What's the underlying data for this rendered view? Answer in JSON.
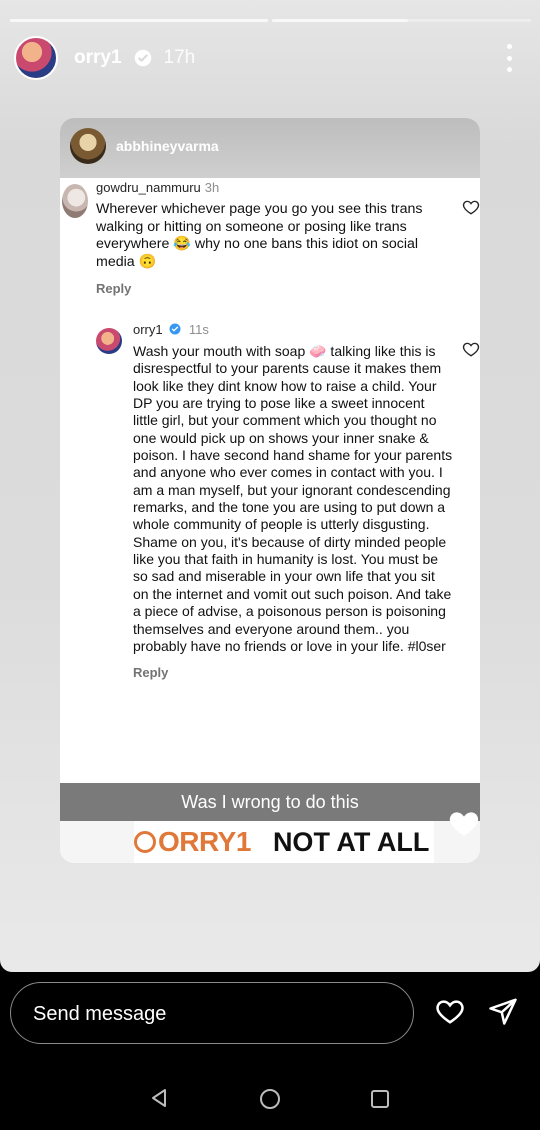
{
  "story": {
    "username": "orry1",
    "time": "17h"
  },
  "card": {
    "username": "abbhineyvarma"
  },
  "comment1": {
    "username": "gowdru_nammuru",
    "time": "3h",
    "text": "Wherever whichever page you go you see this trans walking or hitting on someone or posing like trans everywhere 😂 why no one bans this idiot on social media 🙃",
    "reply": "Reply"
  },
  "comment2": {
    "username": "orry1",
    "time": "11s",
    "text": "Wash your mouth with soap 🧼 talking like this is disrespectful to your parents cause it makes them look like they dint know how to raise a child. Your DP you are trying to pose like a sweet innocent little girl, but your comment which you thought no one would pick up on shows your inner snake & poison. I have second hand shame for your parents and anyone who ever comes in contact with you. I am a man myself, but your ignorant condescending remarks, and the tone you are using to put down a whole community of people is utterly disgusting. Shame on you, it's because of dirty minded people like you that faith in humanity is lost. You must be so sad and miserable in your own life that you sit on the internet and vomit out such poison. And take a piece of advise, a poisonous person is poisoning themselves and everyone around them.. you probably have no friends or love in your life. #l0ser",
    "reply": "Reply"
  },
  "banner": {
    "text": "Was I wrong to do this"
  },
  "answer": {
    "tag": "ORRY1",
    "text": "NOT AT ALL"
  },
  "message": {
    "placeholder": "Send message"
  },
  "colors": {
    "accent": "#e0783a",
    "banner": "#7a7a7a",
    "verified": "#3897f0"
  },
  "icons": [
    "more-icon",
    "verified-icon",
    "heart-icon",
    "send-icon",
    "back-icon",
    "home-icon",
    "recents-icon"
  ]
}
